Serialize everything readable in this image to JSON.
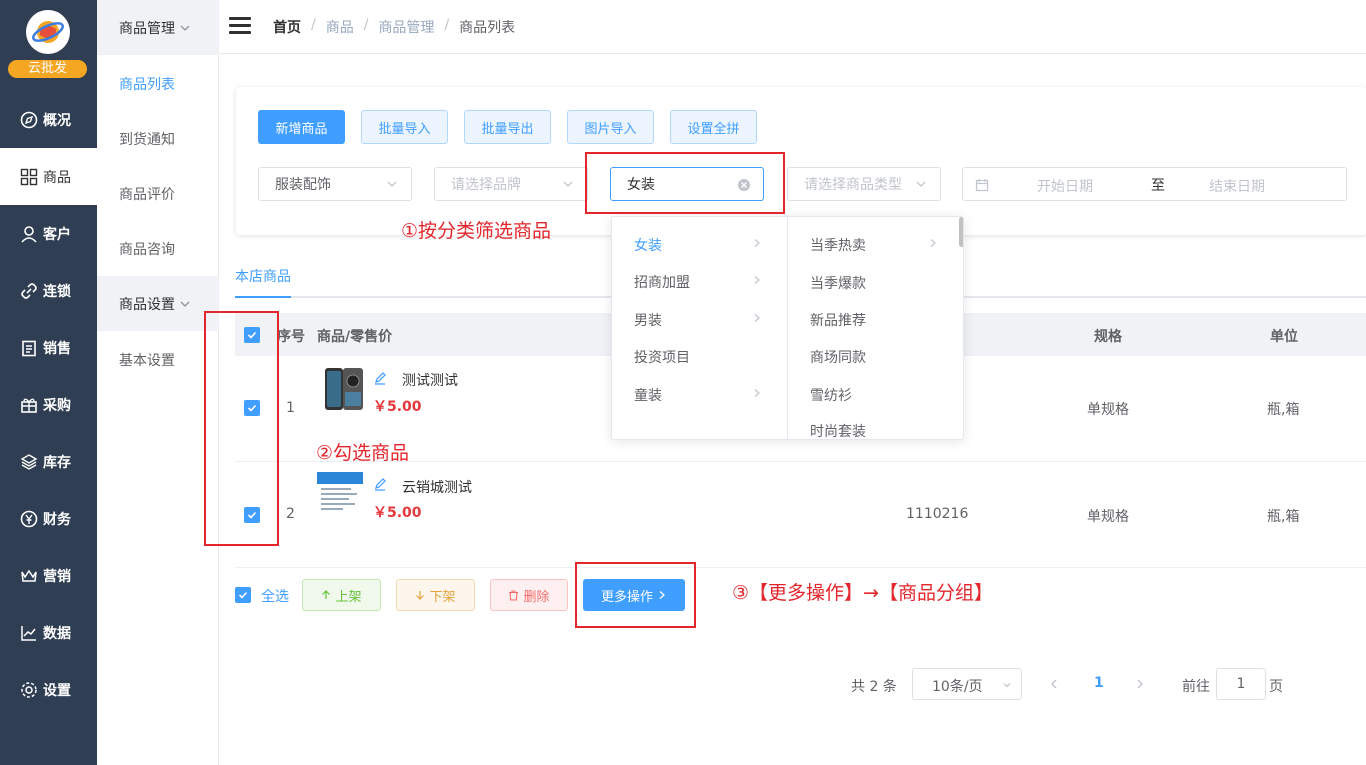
{
  "brand": {
    "badge": "云批发",
    "logo_icon": "planet-logo-icon"
  },
  "sidebar": {
    "items": [
      {
        "label": "概况",
        "icon": "compass-icon"
      },
      {
        "label": "商品",
        "icon": "grid-icon"
      },
      {
        "label": "客户",
        "icon": "user-icon"
      },
      {
        "label": "连锁",
        "icon": "link-icon"
      },
      {
        "label": "销售",
        "icon": "clipboard-icon"
      },
      {
        "label": "采购",
        "icon": "gift-icon"
      },
      {
        "label": "库存",
        "icon": "layers-icon"
      },
      {
        "label": "财务",
        "icon": "yuan-icon"
      },
      {
        "label": "营销",
        "icon": "crown-icon"
      },
      {
        "label": "数据",
        "icon": "chart-icon"
      },
      {
        "label": "设置",
        "icon": "gear-icon"
      }
    ]
  },
  "subnav": {
    "group1": "商品管理",
    "items1": [
      "商品列表",
      "到货通知",
      "商品评价",
      "商品咨询"
    ],
    "group2": "商品设置",
    "items2": [
      "基本设置"
    ]
  },
  "breadcrumb": [
    "首页",
    "商品",
    "商品管理",
    "商品列表"
  ],
  "toolbar": {
    "add": "新增商品",
    "import": "批量导入",
    "export": "批量导出",
    "image_import": "图片导入",
    "pinyin": "设置全拼"
  },
  "filters": {
    "category_value": "服装配饰",
    "brand_placeholder": "请选择品牌",
    "sub_category_value": "女装",
    "type_placeholder": "请选择商品类型",
    "start_date": "开始日期",
    "to": "至",
    "end_date": "结束日期"
  },
  "dropdown": {
    "col1": [
      {
        "label": "女装",
        "has_children": true
      },
      {
        "label": "招商加盟",
        "has_children": true
      },
      {
        "label": "男装",
        "has_children": true
      },
      {
        "label": "投资项目",
        "has_children": false
      },
      {
        "label": "童装",
        "has_children": true
      }
    ],
    "col2": [
      {
        "label": "当季热卖",
        "has_children": true
      },
      {
        "label": "当季爆款",
        "has_children": false
      },
      {
        "label": "新品推荐",
        "has_children": false
      },
      {
        "label": "商场同款",
        "has_children": false
      },
      {
        "label": "雪纺衫",
        "has_children": false
      },
      {
        "label": "时尚套装",
        "has_children": false
      }
    ]
  },
  "tabs": {
    "active": "本店商品"
  },
  "table": {
    "headers": {
      "index": "序号",
      "product": "商品/零售价",
      "spec": "规格",
      "unit": "单位"
    },
    "rows": [
      {
        "index": "1",
        "name": "测试测试",
        "price": "￥5.00",
        "code": "",
        "spec": "单规格",
        "unit": "瓶,箱"
      },
      {
        "index": "2",
        "name": "云销城测试",
        "price": "￥5.00",
        "code": "1110216",
        "spec": "单规格",
        "unit": "瓶,箱"
      }
    ]
  },
  "bulk": {
    "select_all": "全选",
    "on_shelf": "上架",
    "off_shelf": "下架",
    "delete": "删除",
    "more": "更多操作"
  },
  "pagination": {
    "total": "共 2 条",
    "page_size": "10条/页",
    "current": "1",
    "goto": "前往",
    "goto_value": "1",
    "page_suffix": "页"
  },
  "annotations": {
    "a1": "①按分类筛选商品",
    "a2": "②勾选商品",
    "a3": "③【更多操作】→【商品分组】"
  },
  "colors": {
    "primary": "#409eff",
    "sidebar": "#2f3e52",
    "annotation": "#e4262c",
    "price": "#e4393c"
  }
}
